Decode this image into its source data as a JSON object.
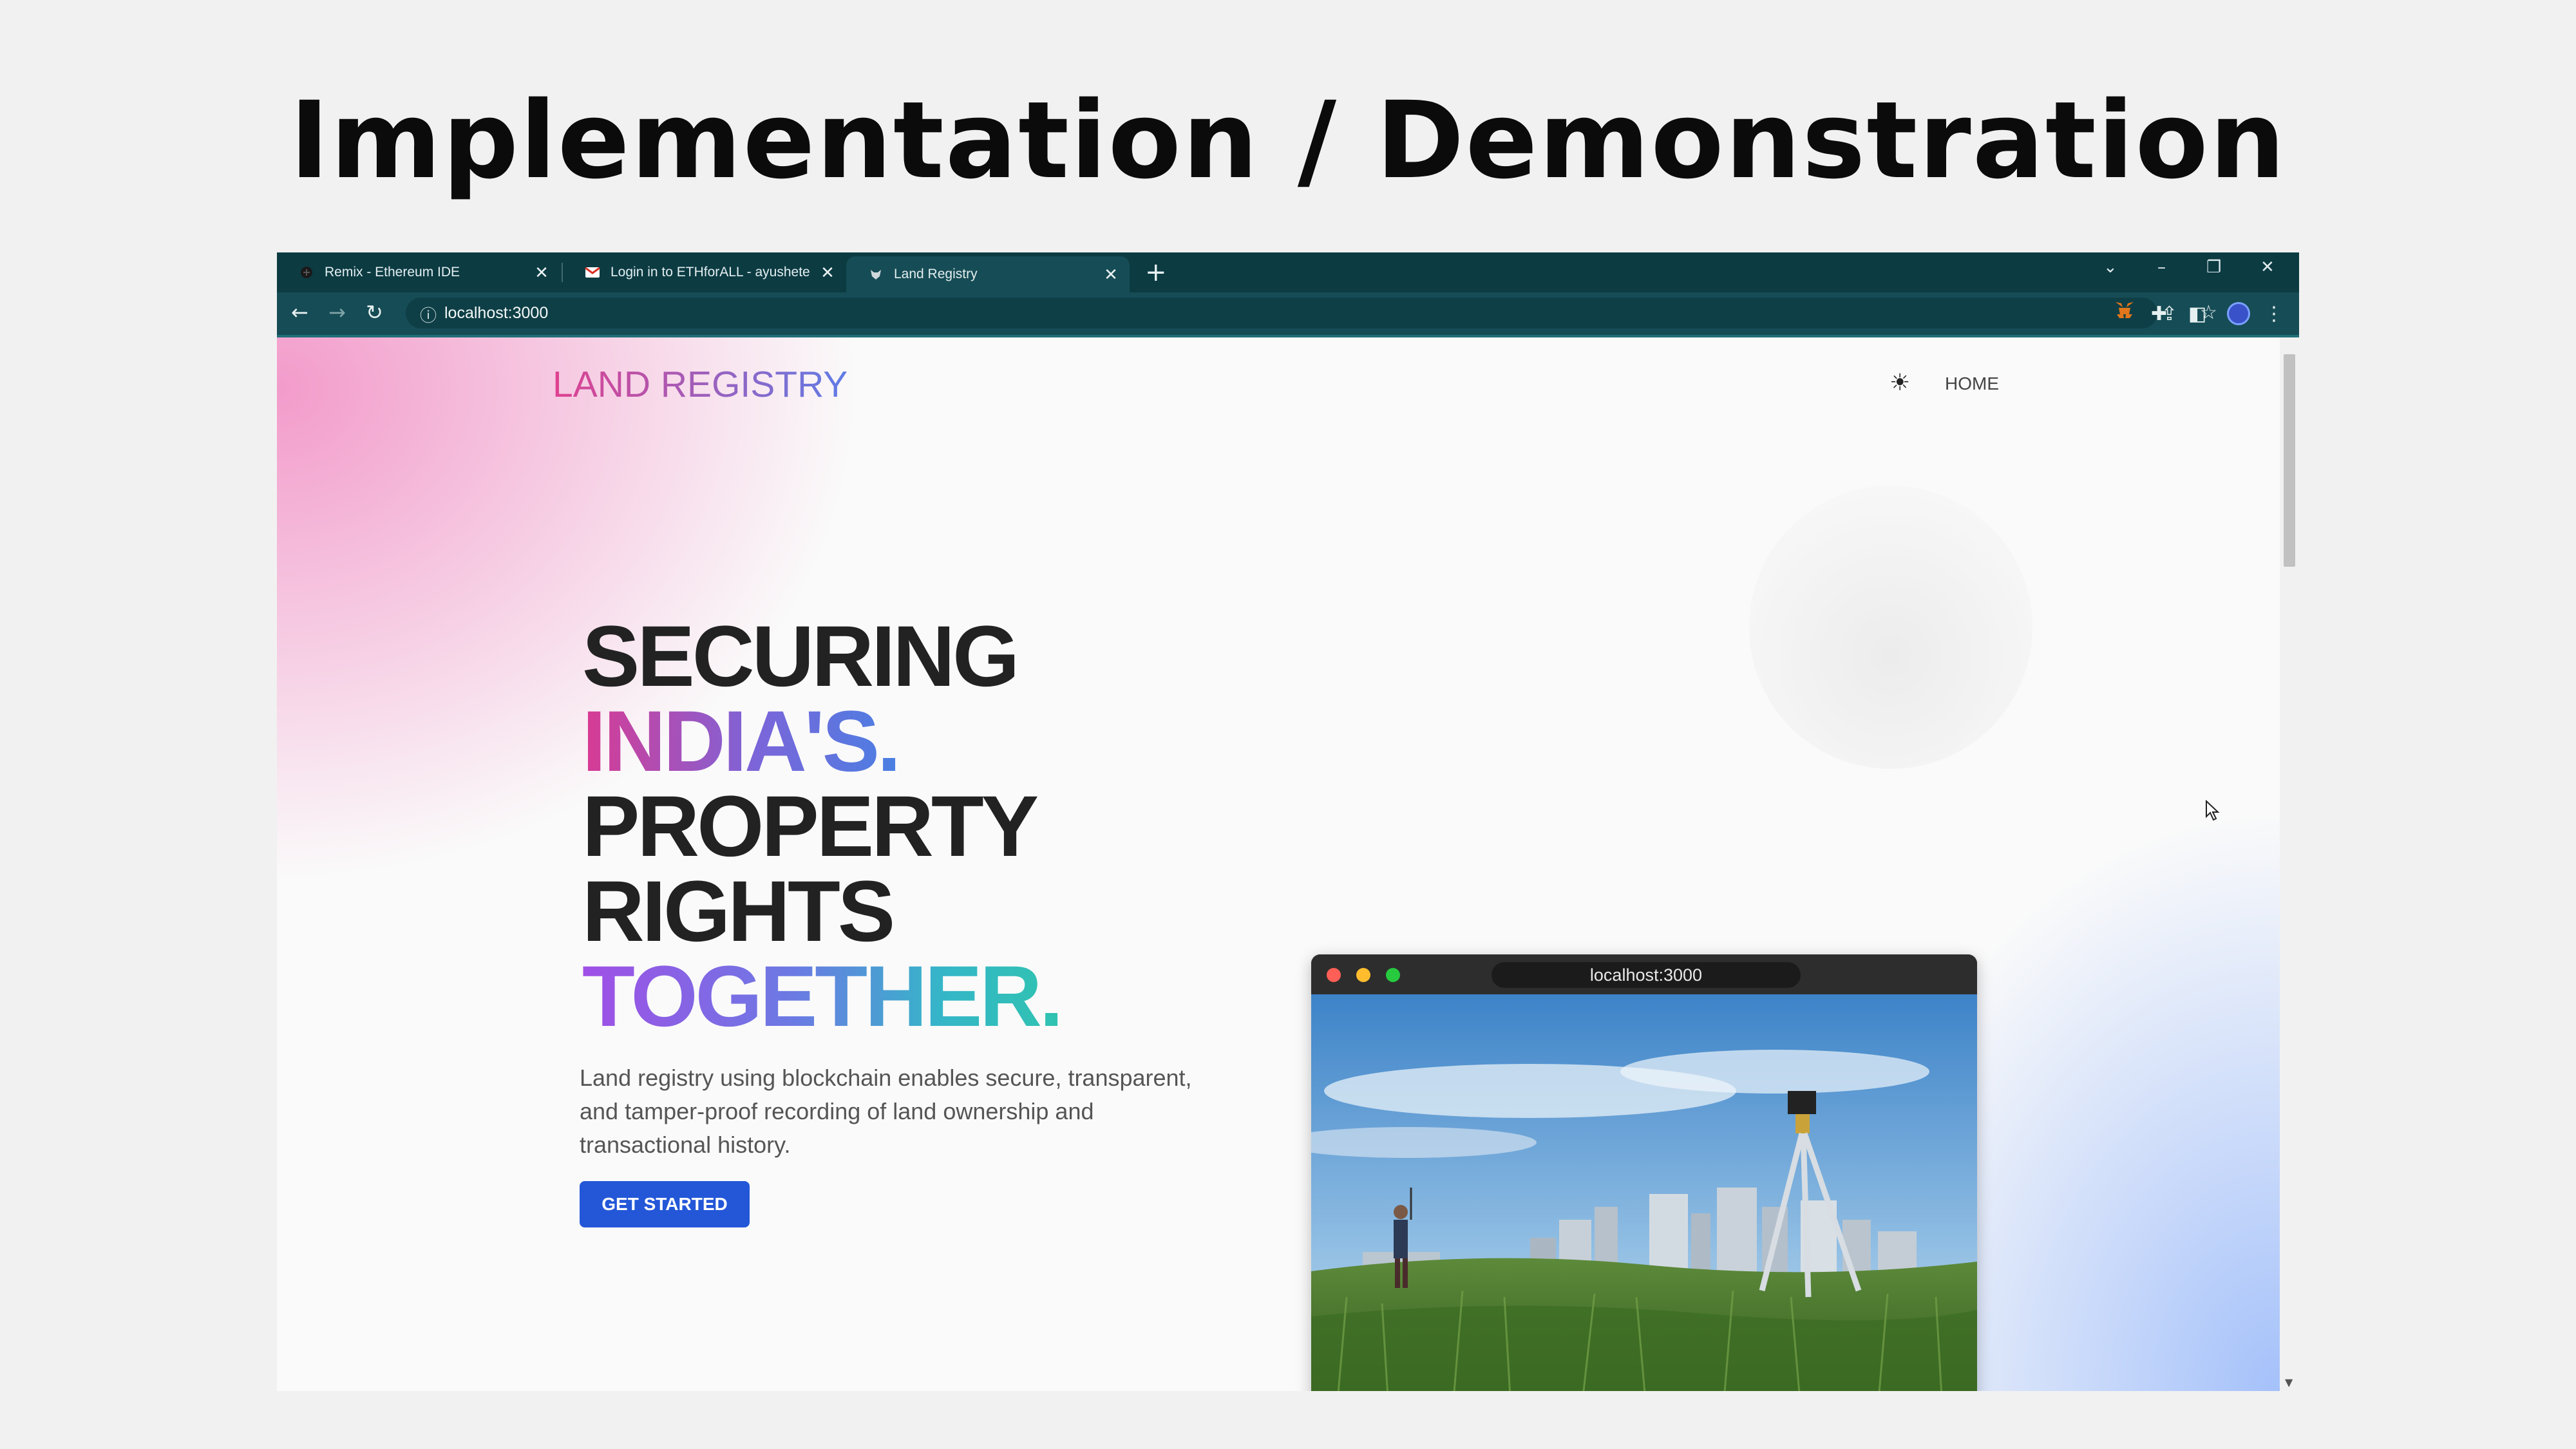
{
  "slide": {
    "title": "Implementation / Demonstration"
  },
  "browser": {
    "tabs": [
      {
        "title": "Remix - Ethereum IDE",
        "icon": "remix-icon"
      },
      {
        "title": "Login in to ETHforALL - ayushete",
        "icon": "gmail-icon"
      },
      {
        "title": "Land Registry",
        "icon": "fox-icon",
        "active": true
      }
    ],
    "close_glyph": "✕",
    "new_tab_glyph": "+",
    "url": "localhost:3000"
  },
  "page": {
    "logo": "LAND REGISTRY",
    "nav": {
      "home": "HOME"
    },
    "hero": {
      "line1": "SECURING",
      "line2": "INDIA'S.",
      "line3": "PROPERTY",
      "line4": "RIGHTS",
      "line5": "TOGETHER."
    },
    "description": "Land registry using blockchain enables secure, transparent, and tamper-proof recording of land ownership and transactional history.",
    "cta": "GET STARTED",
    "mock_window": {
      "url": "localhost:3000"
    }
  },
  "colors": {
    "tabbar": "#0c3b42",
    "accent_button": "#2357d8",
    "logo_gradient_start": "#e0418f",
    "logo_gradient_end": "#5f7ce6"
  }
}
